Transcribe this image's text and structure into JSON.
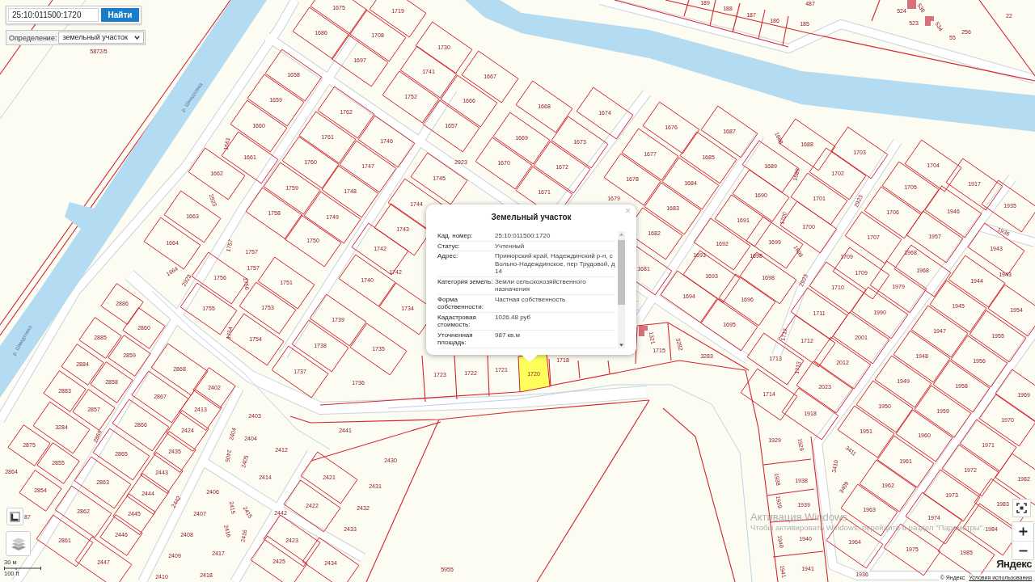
{
  "search": {
    "value": "25:10:011500:1720",
    "button": "Найти"
  },
  "definition": {
    "label": "Определение:",
    "value": "земельный участок"
  },
  "map": {
    "river_labels": [
      "р. Шмидтовка",
      "р. Шмидтовка"
    ],
    "parcel_labels": [
      "5872/5",
      "1675",
      "1719",
      "1686",
      "1708",
      "1697",
      "1730",
      "1658",
      "1741",
      "1667",
      "1659",
      "1752",
      "1666",
      "1762",
      "1660",
      "1657",
      "1661",
      "1761",
      "1746",
      "1661",
      "1760",
      "1747",
      "2923",
      "1670",
      "1662",
      "1745",
      "1759",
      "1748",
      "2923",
      "1744",
      "1663",
      "1758",
      "1749",
      "1743",
      "1664",
      "1750",
      "1757",
      "1757",
      "1742",
      "1757",
      "1742",
      "1664",
      "1756",
      "1756",
      "1751",
      "1740",
      "2923",
      "189",
      "487",
      "188",
      "187",
      "186",
      "185",
      "524",
      "536",
      "523",
      "534",
      "55",
      "256",
      "22",
      "1668",
      "1674",
      "1669",
      "1673",
      "1676",
      "1687",
      "1688",
      "1688",
      "1703",
      "1677",
      "1685",
      "1672",
      "1689",
      "1689",
      "1702",
      "1704",
      "1917",
      "1678",
      "1684",
      "1671",
      "1690",
      "1701",
      "2923",
      "1705",
      "1935",
      "1679",
      "1683",
      "1691",
      "1700",
      "1700",
      "1706",
      "1946",
      "1936",
      "1682",
      "1692",
      "1699",
      "1699",
      "1707",
      "1957",
      "1943",
      "1693",
      "1698",
      "1709",
      "1968",
      "1943",
      "1681",
      "1693",
      "1698",
      "2923",
      "1709",
      "1968",
      "1710",
      "1979",
      "1944",
      "2886",
      "1755",
      "1753",
      "1739",
      "1734",
      "2860",
      "2885",
      "1754",
      "1754",
      "1738",
      "1735",
      "2859",
      "2884",
      "2868",
      "1737",
      "1736",
      "1723",
      "1722",
      "1721",
      "2858",
      "2402",
      "2883",
      "2867",
      "2857",
      "2413",
      "2403",
      "3284",
      "2866",
      "2424",
      "2404",
      "2404",
      "2441",
      "2869",
      "2875",
      "2435",
      "2412",
      "2405",
      "2405",
      "2855",
      "2865",
      "2430",
      "2864",
      "2443",
      "2414",
      "2421",
      "2431",
      "2863",
      "2854",
      "2444",
      "2406",
      "2442",
      "2415",
      "2415",
      "2422",
      "2432",
      "2862",
      "2407",
      "2442",
      "87",
      "2445",
      "2416",
      "2416",
      "2433",
      "2408",
      "2446",
      "2861",
      "2423",
      "2409",
      "2417",
      "2447",
      "2425",
      "2434",
      "5955",
      "2410",
      "2418",
      "1694",
      "1696",
      "1711",
      "1990",
      "1945",
      "1954",
      "1695",
      "1947",
      "1955",
      "2001",
      "1712",
      "1712",
      "1718",
      "1715",
      "1321",
      "3282",
      "3283",
      "1713",
      "1713",
      "2012",
      "1948",
      "1956",
      "2023",
      "1949",
      "1958",
      "1714",
      "1969",
      "1918",
      "1950",
      "1959",
      "1970",
      "1951",
      "1960",
      "1929",
      "1929",
      "3411",
      "1971",
      "1961",
      "3410",
      "1972",
      "1938",
      "1938",
      "3409",
      "1962",
      "1982",
      "1973",
      "1939",
      "1939",
      "1963",
      "1983",
      "1974",
      "1984",
      "1940",
      "1940",
      "1964",
      "1975",
      "1985",
      "1941",
      "1941",
      "1936"
    ],
    "selected_parcel": {
      "label": "1720"
    }
  },
  "popup": {
    "title": "Земельный участок",
    "close": "×",
    "rows": [
      {
        "label": "Кад. номер:",
        "value": "25:10:011500:1720"
      },
      {
        "label": "Статус:",
        "value": "Учтенный"
      },
      {
        "label": "Адрес:",
        "value": "Приморский край, Надеждинский р-н, с Вольно-Надеждинское, пер Трудовой, д 14"
      },
      {
        "label": "Категория земель:",
        "value": "Земли сельскохозяйственного назначения"
      },
      {
        "label": "Форма собственности:",
        "value": "Частная собственность"
      },
      {
        "label": "Кадастровая стоимость:",
        "value": "1026.48 руб"
      },
      {
        "label": "Уточненная площадь:",
        "value": "987 кв.м"
      }
    ]
  },
  "scale": {
    "metric": "30 м",
    "imperial": "100 ft"
  },
  "attribution": {
    "logo": "Яндекс",
    "copyright": "© Яндекс",
    "link": "Условия использования"
  },
  "system_notice": {
    "title": "Активация Windows",
    "text": "Чтобы активировать Windows, перейдите в раздел \"Параметры\"."
  }
}
